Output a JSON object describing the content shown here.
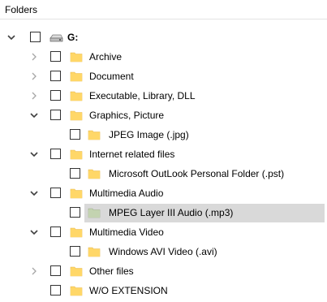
{
  "header": {
    "title": "Folders"
  },
  "tree": {
    "rows": [
      {
        "label": "G:",
        "expander": "expanded",
        "icon": "drive-icon",
        "level": 0,
        "bold": true
      },
      {
        "label": "Archive",
        "expander": "collapsed",
        "icon": "folder-icon",
        "level": 1
      },
      {
        "label": "Document",
        "expander": "collapsed",
        "icon": "folder-icon",
        "level": 1
      },
      {
        "label": "Executable, Library, DLL",
        "expander": "collapsed",
        "icon": "folder-icon",
        "level": 1
      },
      {
        "label": "Graphics, Picture",
        "expander": "expanded",
        "icon": "folder-icon",
        "level": 1
      },
      {
        "label": "JPEG Image (.jpg)",
        "expander": "none",
        "icon": "folder-icon",
        "level": 2
      },
      {
        "label": "Internet related files",
        "expander": "expanded",
        "icon": "folder-icon",
        "level": 1
      },
      {
        "label": "Microsoft OutLook Personal Folder (.pst)",
        "expander": "none",
        "icon": "folder-icon",
        "level": 2
      },
      {
        "label": "Multimedia Audio",
        "expander": "expanded",
        "icon": "folder-icon",
        "level": 1
      },
      {
        "label": "MPEG Layer III Audio (.mp3)",
        "expander": "none",
        "icon": "folder-open-gray-icon",
        "level": 2,
        "selected": true
      },
      {
        "label": "Multimedia Video",
        "expander": "expanded",
        "icon": "folder-icon",
        "level": 1
      },
      {
        "label": "Windows AVI Video (.avi)",
        "expander": "none",
        "icon": "folder-icon",
        "level": 2
      },
      {
        "label": "Other files",
        "expander": "collapsed",
        "icon": "folder-icon",
        "level": 1
      },
      {
        "label": "W/O EXTENSION",
        "expander": "none",
        "icon": "folder-icon",
        "level": 1
      }
    ]
  },
  "colors": {
    "folder": "#ffd768",
    "folder_dark": "#e8b84a",
    "selected_folder": "#c3d3b0",
    "selection_bg": "#d9d9d9",
    "expander_collapsed": "#a6a6a6",
    "expander_expanded": "#404040"
  }
}
